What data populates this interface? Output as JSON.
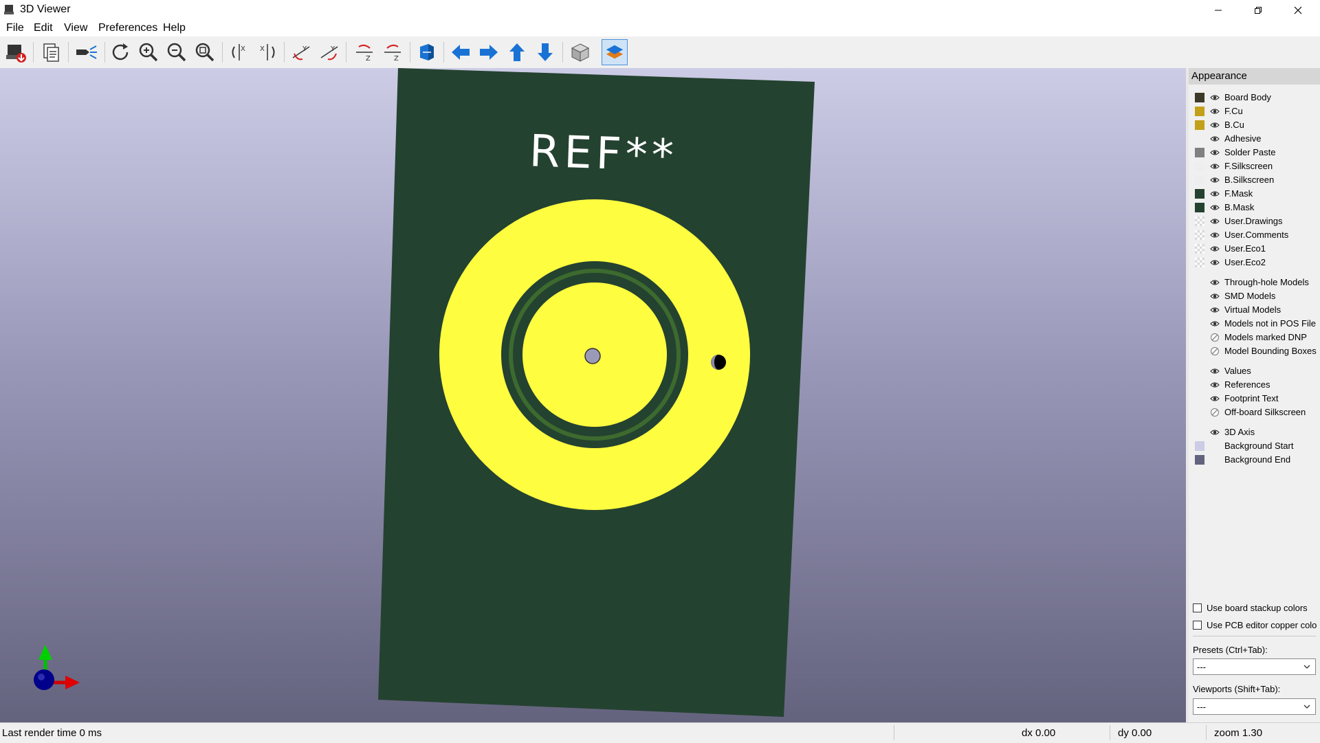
{
  "window": {
    "title": "3D Viewer"
  },
  "menu": {
    "items": [
      "File",
      "Edit",
      "View",
      "Preferences",
      "Help"
    ]
  },
  "colors": {
    "board_mask": "#244230",
    "copper": "#fffd40",
    "silkscreen": "#ffffff",
    "background_start": "#cccce6",
    "background_end": "#64637e",
    "accent": "#1a73d4"
  },
  "toolbar": {
    "buttons": [
      "export-image-icon",
      "copy-to-clipboard-icon",
      "raytracing-icon",
      "reload-icon",
      "zoom-in-icon",
      "zoom-out-icon",
      "zoom-fit-icon",
      "rotate-x-cw-icon",
      "rotate-x-ccw-icon",
      "rotate-y-cw-icon",
      "rotate-y-ccw-icon",
      "rotate-z-cw-icon",
      "rotate-z-ccw-icon",
      "flip-board-icon",
      "pan-left-icon",
      "pan-right-icon",
      "pan-up-icon",
      "pan-down-icon",
      "orthographic-icon",
      "layers-manager-icon"
    ]
  },
  "board": {
    "reference": "REF**"
  },
  "appearance": {
    "title": "Appearance",
    "layers": [
      {
        "label": "Board Body",
        "color": "#3d3a2a",
        "visible": true
      },
      {
        "label": "F.Cu",
        "color": "#c2a01a",
        "visible": true
      },
      {
        "label": "B.Cu",
        "color": "#c2a01a",
        "visible": true
      },
      {
        "label": "Adhesive",
        "color": "",
        "visible": true
      },
      {
        "label": "Solder Paste",
        "color": "#808080",
        "visible": true
      },
      {
        "label": "F.Silkscreen",
        "color": "#eeeeee",
        "visible": true
      },
      {
        "label": "B.Silkscreen",
        "color": "#eeeeee",
        "visible": true
      },
      {
        "label": "F.Mask",
        "color": "#244230",
        "visible": true
      },
      {
        "label": "B.Mask",
        "color": "#244230",
        "visible": true
      },
      {
        "label": "User.Drawings",
        "color": "checker",
        "visible": true
      },
      {
        "label": "User.Comments",
        "color": "checker",
        "visible": true
      },
      {
        "label": "User.Eco1",
        "color": "checker",
        "visible": true
      },
      {
        "label": "User.Eco2",
        "color": "checker",
        "visible": true
      }
    ],
    "models": [
      {
        "label": "Through-hole Models",
        "visible": true
      },
      {
        "label": "SMD Models",
        "visible": true
      },
      {
        "label": "Virtual Models",
        "visible": true
      },
      {
        "label": "Models not in POS File",
        "visible": true
      },
      {
        "label": "Models marked DNP",
        "visible": false
      },
      {
        "label": "Model Bounding Boxes",
        "visible": false
      }
    ],
    "text": [
      {
        "label": "Values",
        "visible": true
      },
      {
        "label": "References",
        "visible": true
      },
      {
        "label": "Footprint Text",
        "visible": true
      },
      {
        "label": "Off-board Silkscreen",
        "visible": false
      }
    ],
    "misc": [
      {
        "label": "3D Axis",
        "color": "",
        "visible": true
      },
      {
        "label": "Background Start",
        "color": "#cccce6",
        "visible": null
      },
      {
        "label": "Background End",
        "color": "#64637e",
        "visible": null
      }
    ],
    "checkboxes": [
      {
        "label": "Use board stackup colors",
        "checked": false
      },
      {
        "label": "Use PCB editor copper colo",
        "checked": false
      }
    ],
    "presets_label": "Presets (Ctrl+Tab):",
    "presets_value": "---",
    "viewports_label": "Viewports (Shift+Tab):",
    "viewports_value": "---"
  },
  "status": {
    "render_time": "Last render time 0 ms",
    "dx": "dx 0.00",
    "dy": "dy 0.00",
    "zoom": "zoom 1.30"
  }
}
